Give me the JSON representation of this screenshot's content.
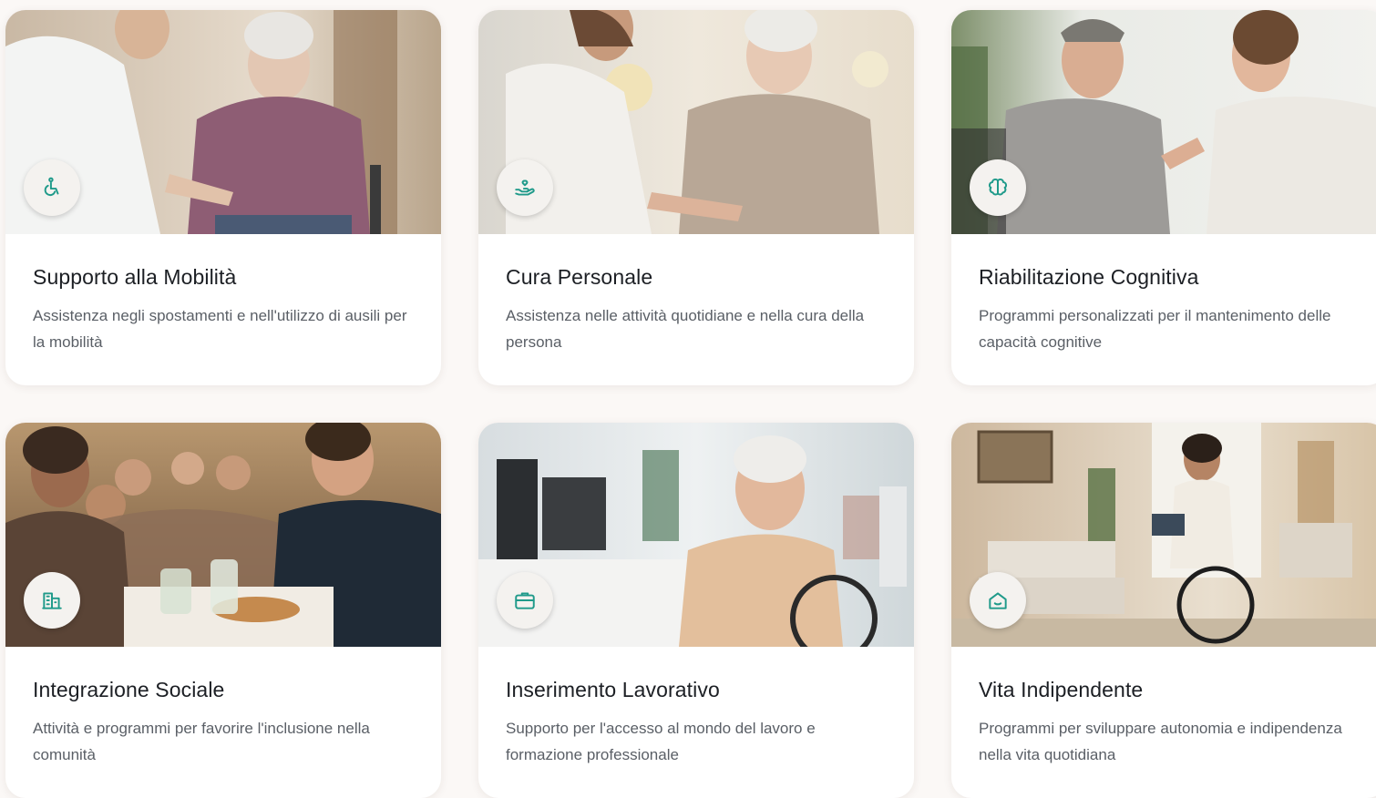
{
  "colors": {
    "accent": "#1f9a8a",
    "title": "#1c1f24",
    "text": "#5a5f66",
    "background": "#fbf8f6"
  },
  "services": [
    {
      "title": "Supporto alla Mobilità",
      "description": "Assistenza negli spostamenti e nell'utilizzo di ausili per la mobilità",
      "icon": "wheelchair-icon"
    },
    {
      "title": "Cura Personale",
      "description": "Assistenza nelle attività quotidiane e nella cura della persona",
      "icon": "hand-heart-icon"
    },
    {
      "title": "Riabilitazione Cognitiva",
      "description": "Programmi personalizzati per il mantenimento delle capacità cognitive",
      "icon": "brain-icon"
    },
    {
      "title": "Integrazione Sociale",
      "description": "Attività e programmi per favorire l'inclusione nella comunità",
      "icon": "building-icon"
    },
    {
      "title": "Inserimento Lavorativo",
      "description": "Supporto per l'accesso al mondo del lavoro e formazione professionale",
      "icon": "briefcase-icon"
    },
    {
      "title": "Vita Indipendente",
      "description": "Programmi per sviluppare autonomia e indipendenza nella vita quotidiana",
      "icon": "home-icon"
    }
  ]
}
